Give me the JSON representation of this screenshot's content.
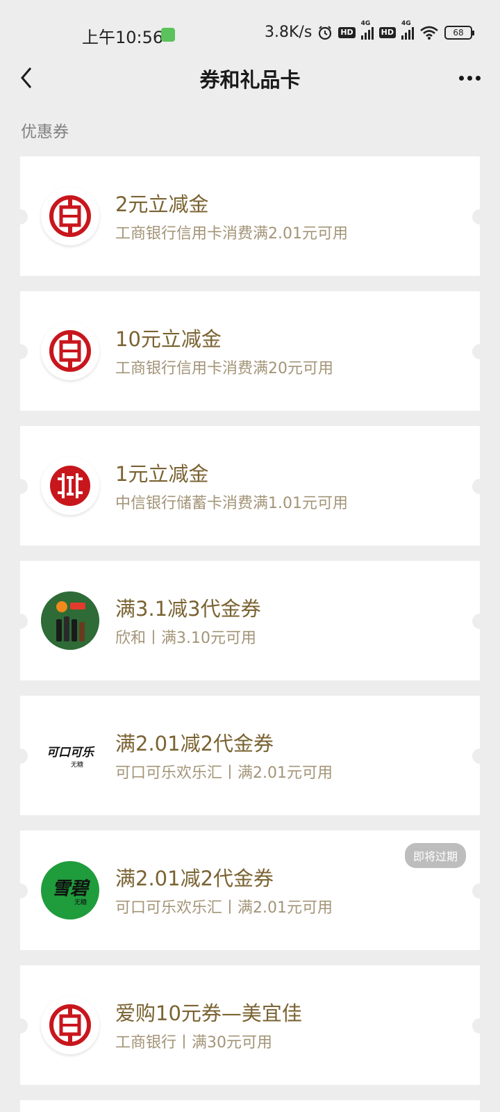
{
  "status_bar": {
    "time": "上午10:56",
    "net_speed": "3.8K/s",
    "hd1": "HD",
    "net1": "4G",
    "hd2": "HD",
    "net2": "4G",
    "battery": "68"
  },
  "header": {
    "title": "券和礼品卡"
  },
  "section": {
    "label": "优惠券"
  },
  "coupons": [
    {
      "title": "2元立减金",
      "desc": "工商银行信用卡消费满2.01元可用",
      "logo": "icbc-logo-icon"
    },
    {
      "title": "10元立减金",
      "desc": "工商银行信用卡消费满20元可用",
      "logo": "icbc-logo-icon"
    },
    {
      "title": "1元立减金",
      "desc": "中信银行储蓄卡消费满1.01元可用",
      "logo": "citic-logo-icon"
    },
    {
      "title": "满3.1减3代金券",
      "desc": "欣和丨满3.10元可用",
      "logo": "xinhe-logo-icon"
    },
    {
      "title": "满2.01减2代金券",
      "desc": "可口可乐欢乐汇丨满2.01元可用",
      "logo": "cocacola-logo-icon",
      "logo_text": "可口可乐",
      "logo_sub": "无糖"
    },
    {
      "title": "满2.01减2代金券",
      "desc": "可口可乐欢乐汇丨满2.01元可用",
      "logo": "sprite-logo-icon",
      "logo_text": "雪碧",
      "logo_sub": "无糖",
      "badge": "即将过期"
    },
    {
      "title": "爱购10元券—美宜佳",
      "desc": "工商银行丨满30元可用",
      "logo": "icbc-logo-icon"
    }
  ],
  "colors": {
    "background": "#ededed",
    "title_gold": "#7a6332",
    "desc_gold": "#a39478",
    "icbc_red": "#c8161d",
    "sprite_green": "#1f9c3c"
  }
}
